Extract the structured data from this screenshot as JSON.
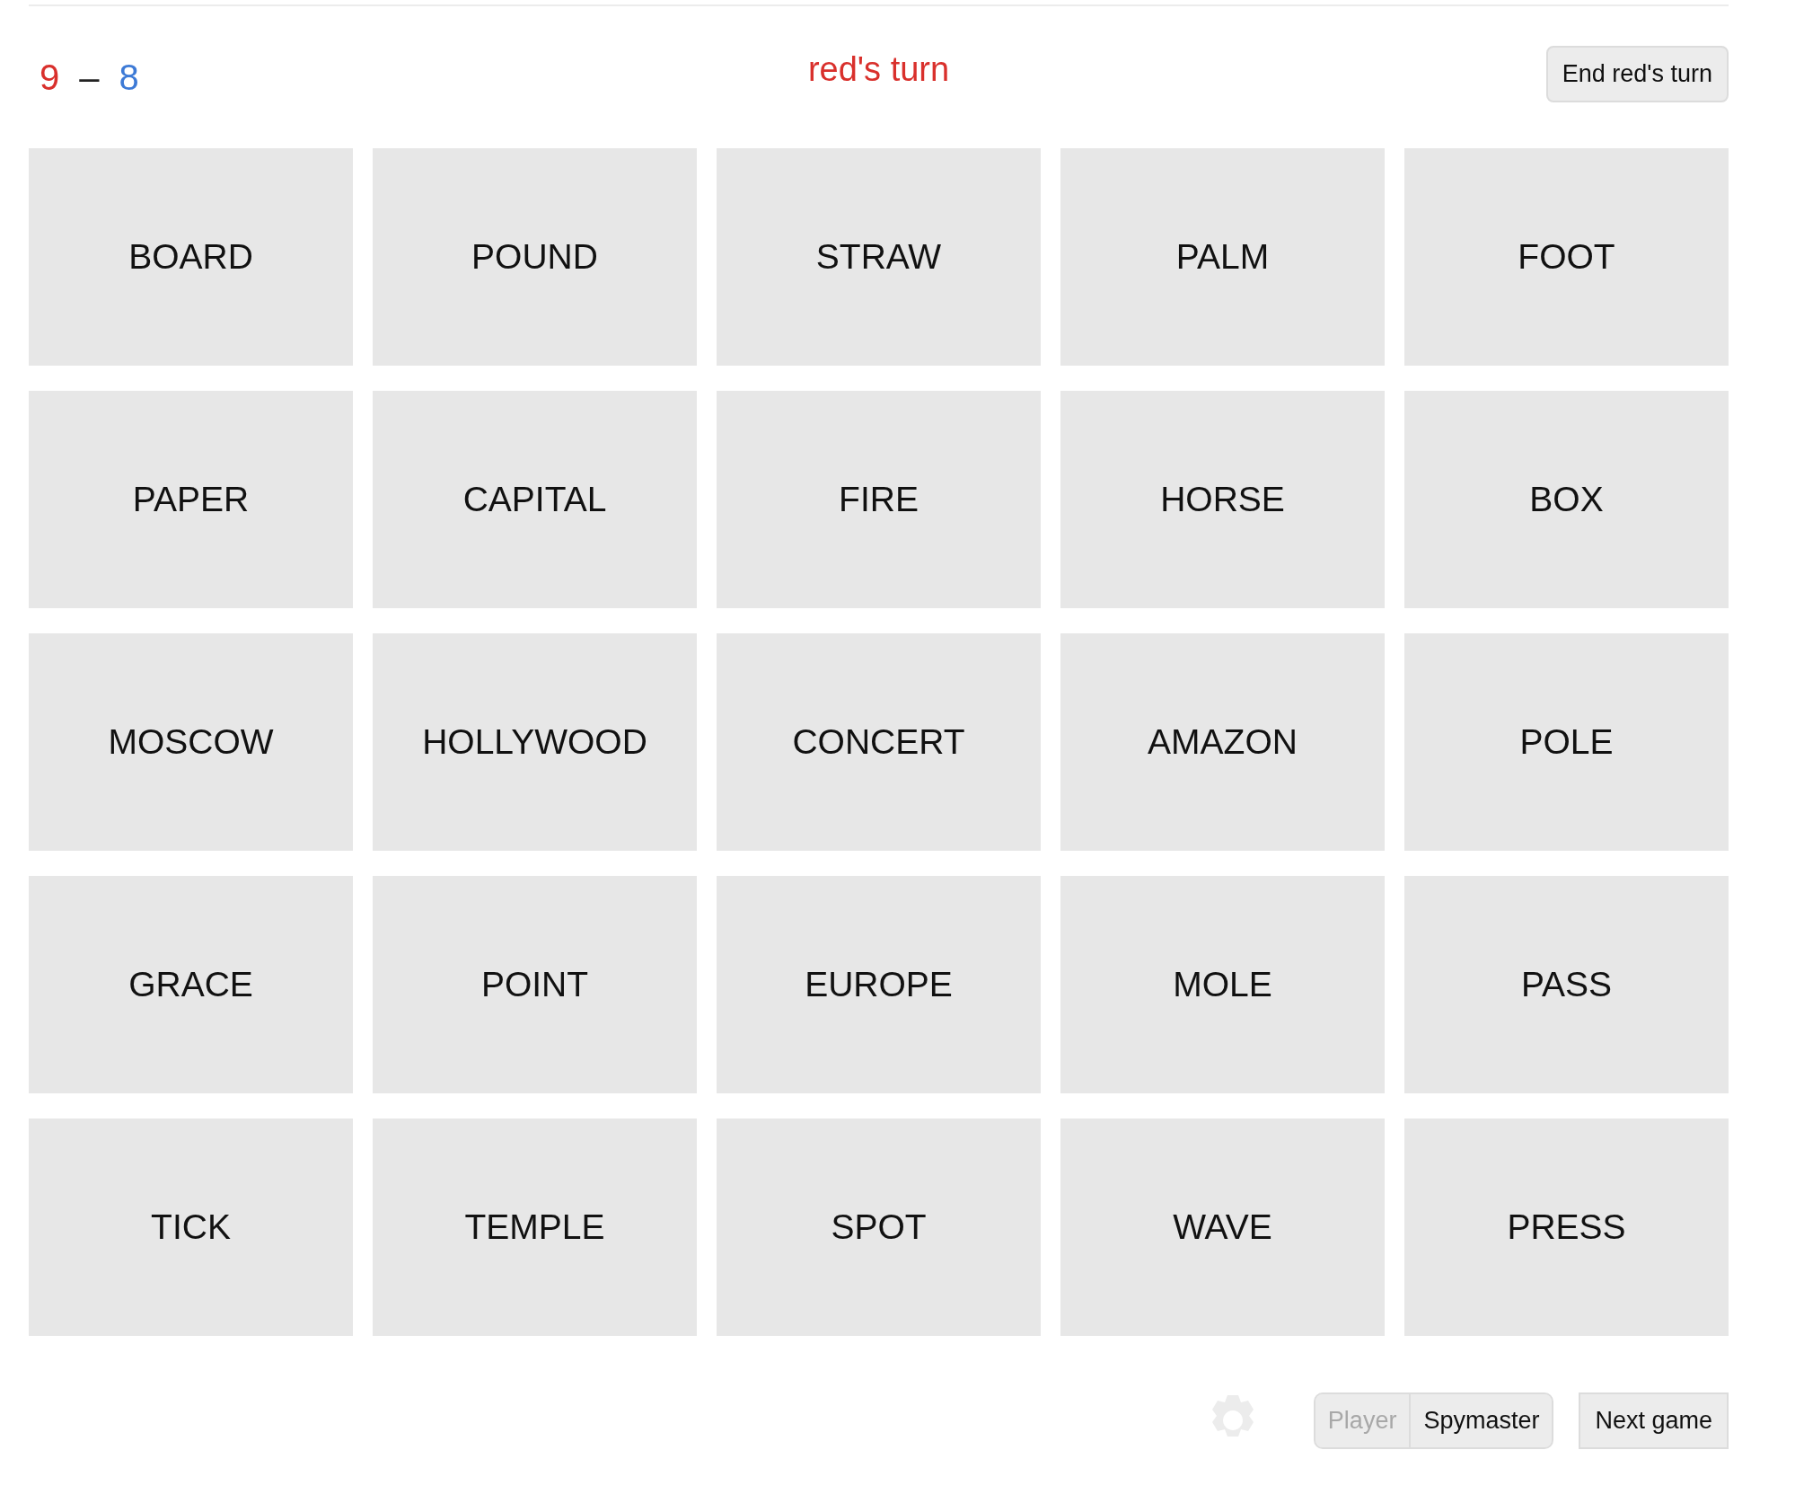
{
  "score": {
    "red": "9",
    "separator": "–",
    "blue": "8"
  },
  "turn": {
    "label": "red's turn",
    "color": "#d9302c"
  },
  "end_turn_button": "End red's turn",
  "cards": [
    "BOARD",
    "POUND",
    "STRAW",
    "PALM",
    "FOOT",
    "PAPER",
    "CAPITAL",
    "FIRE",
    "HORSE",
    "BOX",
    "MOSCOW",
    "HOLLYWOOD",
    "CONCERT",
    "AMAZON",
    "POLE",
    "GRACE",
    "POINT",
    "EUROPE",
    "MOLE",
    "PASS",
    "TICK",
    "TEMPLE",
    "SPOT",
    "WAVE",
    "PRESS"
  ],
  "mode_toggle": [
    {
      "label": "Player",
      "selected": true
    },
    {
      "label": "Spymaster",
      "selected": false
    }
  ],
  "next_game_button": "Next game"
}
